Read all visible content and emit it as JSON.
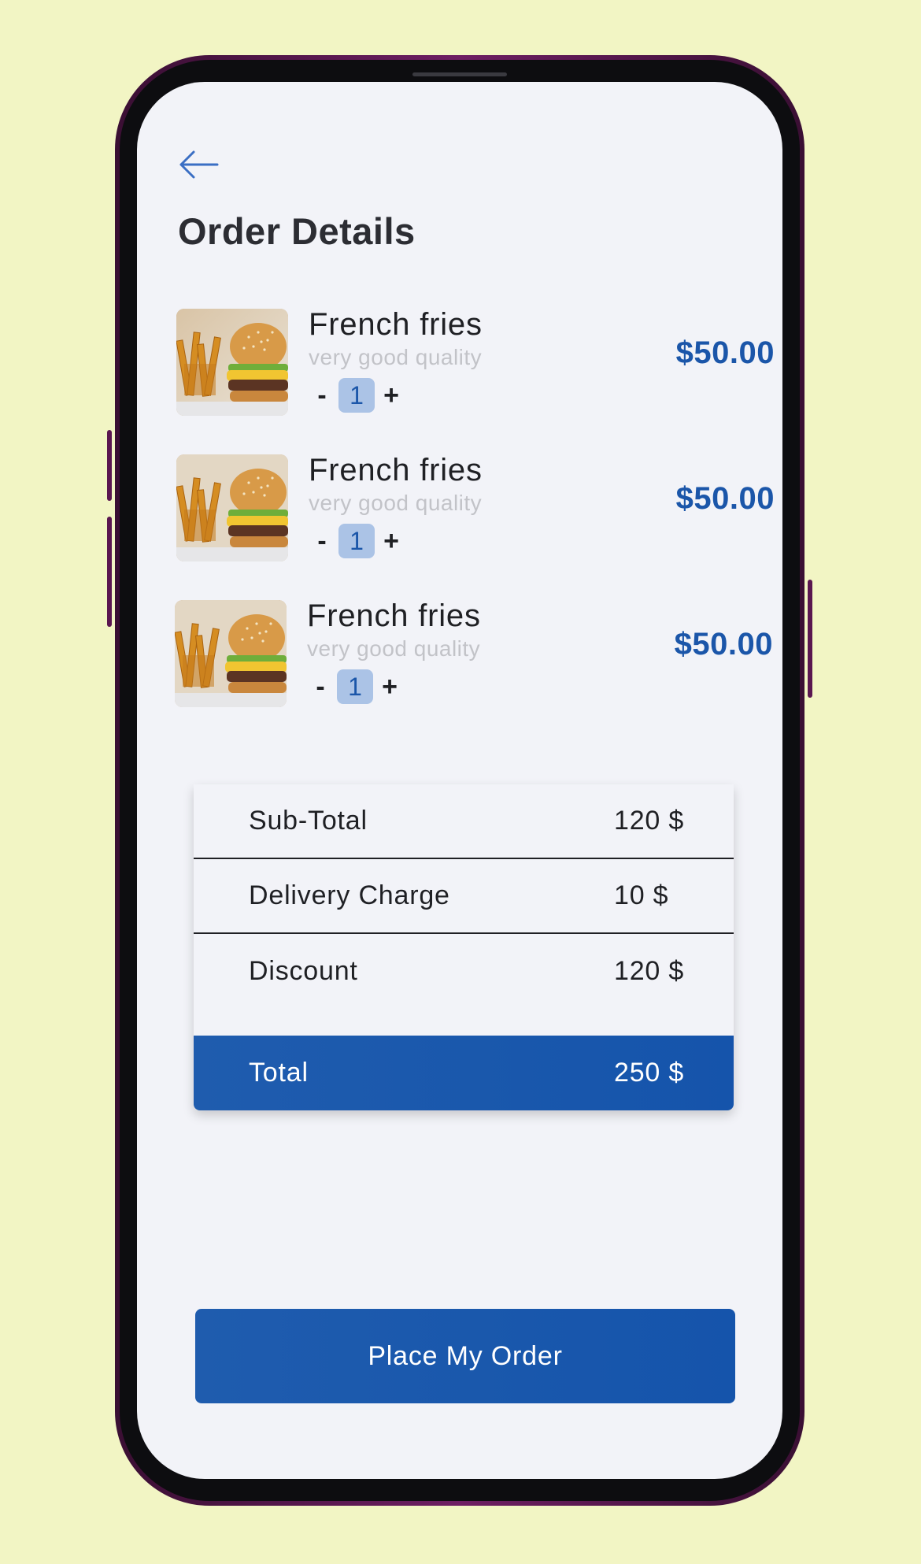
{
  "header": {
    "title": "Order Details"
  },
  "items": [
    {
      "name": "French fries",
      "subtitle": "very good quality",
      "quantity": "1",
      "price": "$50.00",
      "minus": "-",
      "plus": "+"
    },
    {
      "name": "French fries",
      "subtitle": "very good quality",
      "quantity": "1",
      "price": "$50.00",
      "minus": "-",
      "plus": "+"
    },
    {
      "name": "French fries",
      "subtitle": "very good quality",
      "quantity": "1",
      "price": "$50.00",
      "minus": "-",
      "plus": "+"
    }
  ],
  "summary": {
    "subtotal": {
      "label": "Sub-Total",
      "value": "120 $"
    },
    "delivery": {
      "label": "Delivery Charge",
      "value": "10 $"
    },
    "discount": {
      "label": "Discount",
      "value": "120 $"
    },
    "total": {
      "label": "Total",
      "value": "250 $"
    }
  },
  "cta": {
    "label": "Place My Order"
  },
  "colors": {
    "accent": "#1b56a9",
    "qty_bg": "#abc3e6",
    "background": "#f2f5c4",
    "screen": "#f2f3f8",
    "phone_frame": "#6e1e63"
  },
  "icons": {
    "back": "arrow-left-icon",
    "product": "burger-fries-photo"
  }
}
